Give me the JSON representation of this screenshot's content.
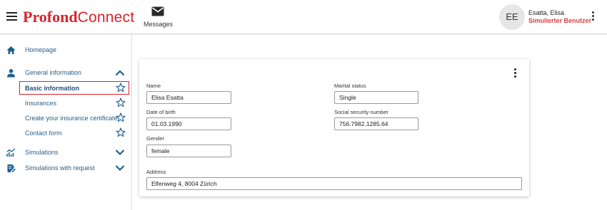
{
  "header": {
    "logo_part1": "Profond",
    "logo_part2": "Connect",
    "messages_label": "Messages",
    "avatar_initials": "EE",
    "user_name": "Esatta, Elisa",
    "user_role": "Simulierter Benutzer"
  },
  "sidebar": {
    "homepage": "Homepage",
    "general_information": "General information",
    "sub_items": [
      {
        "label": "Basic information",
        "active": true
      },
      {
        "label": "Insurances"
      },
      {
        "label": "Create your insurance certificate"
      },
      {
        "label": "Contact form"
      }
    ],
    "simulations": "Simulations",
    "simulations_with_request": "Simulations with request"
  },
  "form": {
    "name_label": "Name",
    "name_value": "Elisa Esatta",
    "marital_status_label": "Marital status",
    "marital_status_value": "Single",
    "dob_label": "Date of birth",
    "dob_value": "01.03.1990",
    "ssn_label": "Social security number",
    "ssn_value": "756.7982.1285.64",
    "gender_label": "Gender",
    "gender_value": "female",
    "address_label": "Address",
    "address_value": "Elfenweg 4, 8004 Zürich"
  },
  "colors": {
    "brand_red": "#d8232a",
    "nav_blue": "#2b5f87",
    "icon_blue": "#1f5f8f",
    "active_border": "#d8232a"
  },
  "icons": {
    "menu": "hamburger-icon",
    "messages": "envelope-icon",
    "more": "more-vertical-icon",
    "home": "home-icon",
    "person": "person-icon",
    "simulations": "chart-icon",
    "simulations_request": "document-edit-icon",
    "favorite": "star-outline-icon",
    "expand": "chevron-down-icon",
    "collapse": "chevron-up-icon"
  }
}
